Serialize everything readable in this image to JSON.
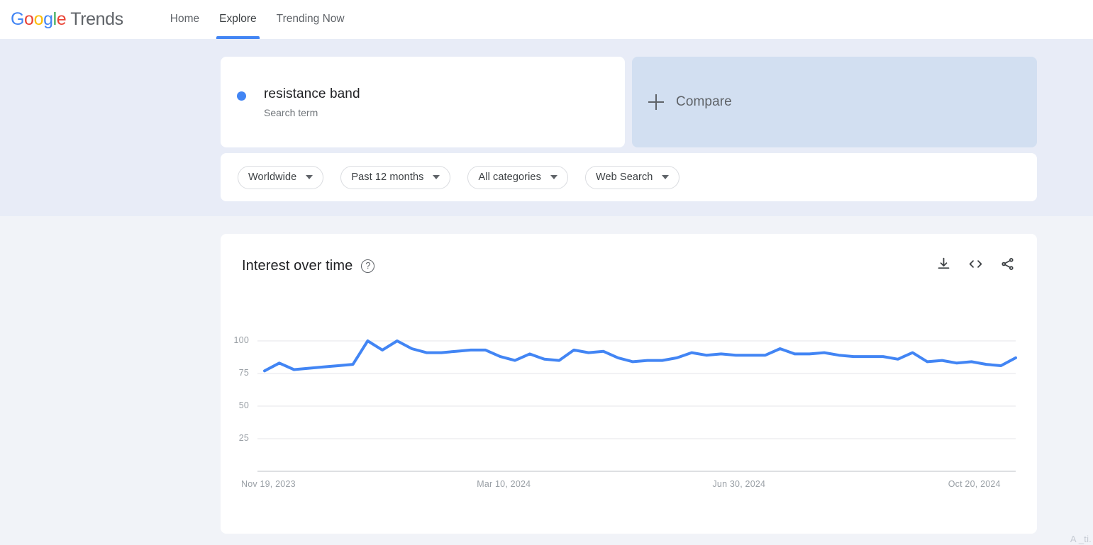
{
  "header": {
    "logo": {
      "google": "Google",
      "product": "Trends"
    },
    "nav": [
      {
        "label": "Home",
        "active": false
      },
      {
        "label": "Explore",
        "active": true
      },
      {
        "label": "Trending Now",
        "active": false
      }
    ]
  },
  "query": {
    "term": {
      "title": "resistance band",
      "subtitle": "Search term",
      "color": "#4285f4"
    },
    "compare": {
      "label": "Compare",
      "icon": "plus-icon"
    }
  },
  "filters": [
    {
      "label": "Worldwide"
    },
    {
      "label": "Past 12 months"
    },
    {
      "label": "All categories"
    },
    {
      "label": "Web Search"
    }
  ],
  "chart_card": {
    "title": "Interest over time",
    "help_icon": "?",
    "actions": [
      {
        "name": "download-icon"
      },
      {
        "name": "embed-code-icon"
      },
      {
        "name": "share-icon"
      }
    ]
  },
  "footer_partial": "A  _ti.",
  "chart_data": {
    "type": "line",
    "title": "Interest over time",
    "xlabel": "",
    "ylabel": "",
    "ylim": [
      0,
      100
    ],
    "ytick_labels": [
      "100",
      "75",
      "50",
      "25"
    ],
    "ytick_values": [
      100,
      75,
      50,
      25
    ],
    "grid": true,
    "legend": false,
    "line_color": "#4285f4",
    "xtick_labels": [
      "Nov 19, 2023",
      "Mar 10, 2024",
      "Jun 30, 2024",
      "Oct 20, 2024"
    ],
    "xtick_index": [
      0,
      16,
      32,
      48
    ],
    "series": [
      {
        "name": "resistance band",
        "color": "#4285f4",
        "values": [
          77,
          83,
          78,
          79,
          80,
          81,
          82,
          100,
          93,
          100,
          94,
          91,
          91,
          92,
          93,
          93,
          88,
          85,
          90,
          86,
          85,
          93,
          91,
          92,
          87,
          84,
          85,
          85,
          87,
          91,
          89,
          90,
          89,
          89,
          89,
          94,
          90,
          90,
          91,
          89,
          88,
          88,
          88,
          86,
          91,
          84,
          85,
          83,
          84,
          82,
          81,
          87
        ]
      }
    ]
  }
}
